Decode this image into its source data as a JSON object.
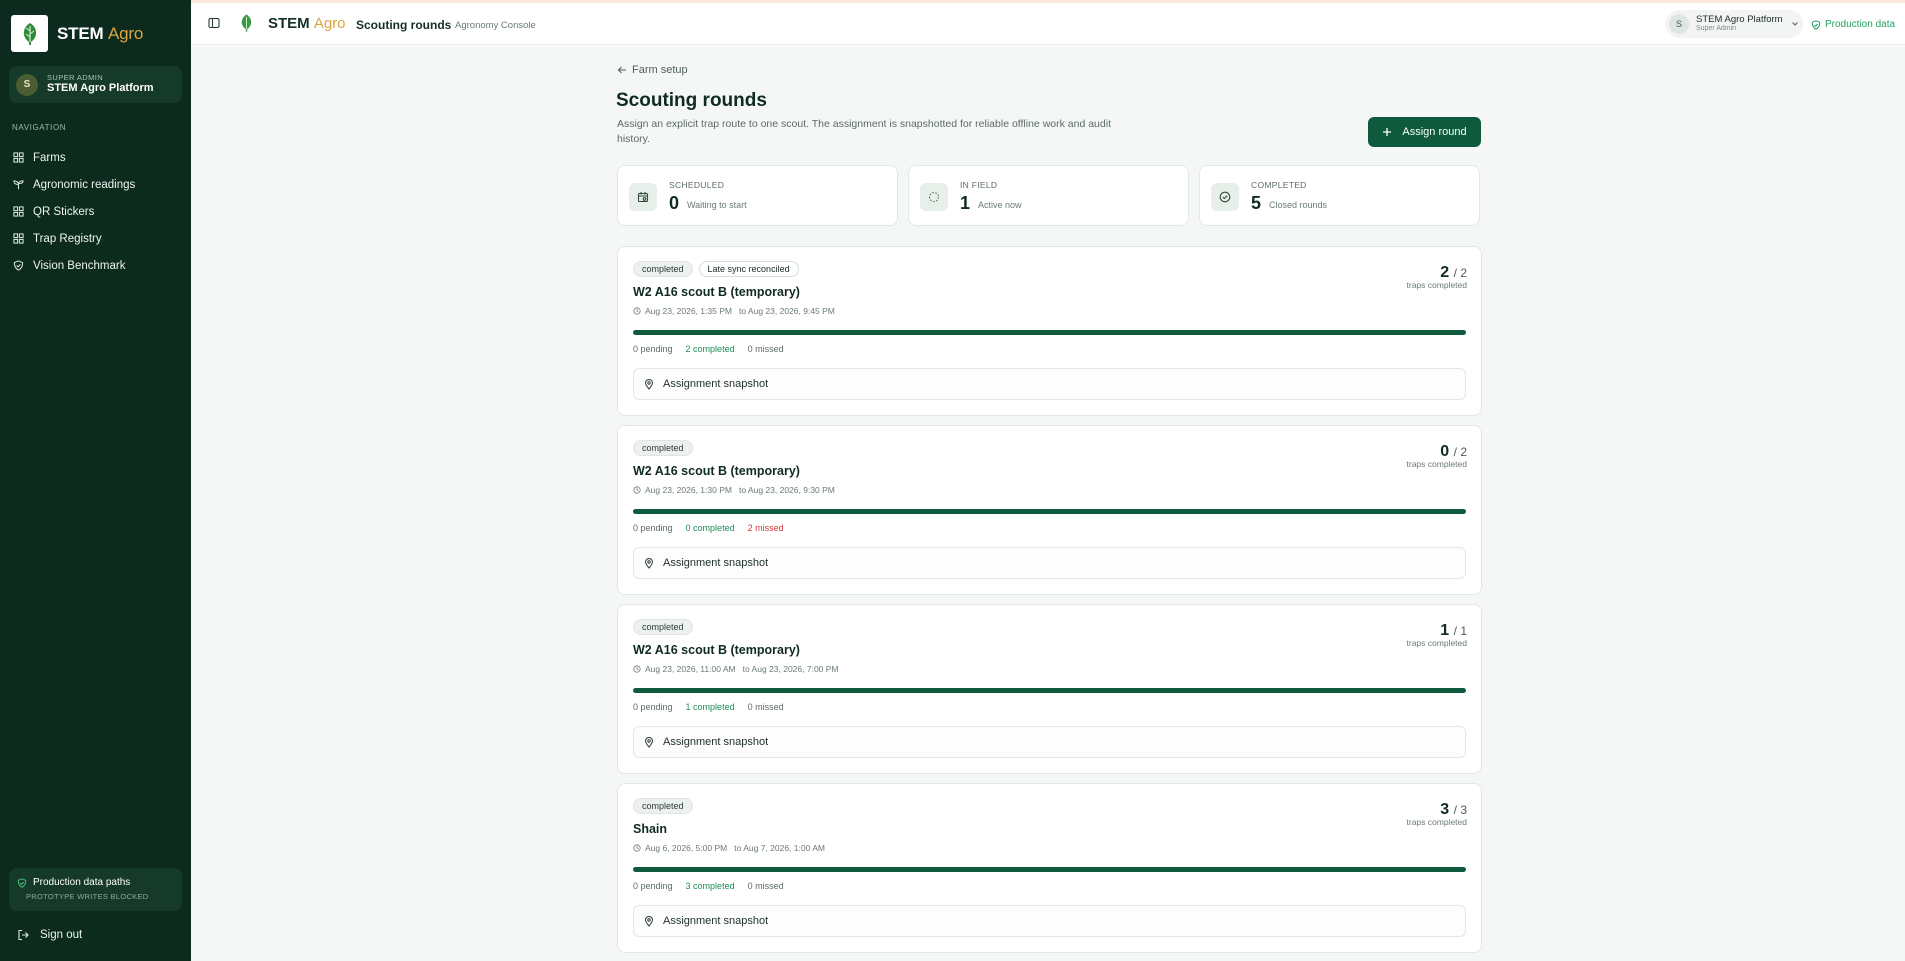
{
  "app": {
    "brand_main": "STEM",
    "brand_accent": "Agro"
  },
  "sidebar": {
    "user_role": "SUPER ADMIN",
    "user_name": "STEM Agro Platform",
    "avatar_letter": "S",
    "nav_label": "NAVIGATION",
    "items": [
      {
        "label": "Farms",
        "icon": "grid-icon"
      },
      {
        "label": "Agronomic readings",
        "icon": "sprout-icon"
      },
      {
        "label": "QR Stickers",
        "icon": "grid-icon"
      },
      {
        "label": "Trap Registry",
        "icon": "grid-icon"
      },
      {
        "label": "Vision Benchmark",
        "icon": "shield-check-icon"
      }
    ],
    "prod_title": "Production data paths",
    "prod_sub": "PROTOTYPE WRITES BLOCKED",
    "signout": "Sign out"
  },
  "topbar": {
    "page_title": "Scouting rounds",
    "subtitle": "Agronomy Console",
    "user_name": "STEM Agro Platform",
    "user_role": "Super Admin",
    "avatar_letter": "S",
    "prod_badge": "Production data"
  },
  "page": {
    "back_label": "Farm setup",
    "title": "Scouting rounds",
    "description": "Assign an explicit trap route to one scout. The assignment is snapshotted for reliable offline work and audit history.",
    "assign_label": "Assign round"
  },
  "stats": [
    {
      "label": "SCHEDULED",
      "value": "0",
      "desc": "Waiting to start",
      "icon": "calendar-icon"
    },
    {
      "label": "IN FIELD",
      "value": "1",
      "desc": "Active now",
      "icon": "loader-icon"
    },
    {
      "label": "COMPLETED",
      "value": "5",
      "desc": "Closed rounds",
      "icon": "check-circle-icon"
    }
  ],
  "rounds_caption": "traps completed",
  "snapshot_label": "Assignment snapshot",
  "rounds": [
    {
      "status": "completed",
      "extra_badge": "Late sync reconciled",
      "name": "W2 A16 scout B (temporary)",
      "from": "Aug 23, 2026, 1:35 PM",
      "to": "to Aug 23, 2026, 9:45 PM",
      "done": "2",
      "total": "/ 2",
      "pending": "0 pending",
      "completed": "2 completed",
      "missed": "0 missed",
      "missed_alert": false,
      "progress": 1.0
    },
    {
      "status": "completed",
      "extra_badge": "",
      "name": "W2 A16 scout B (temporary)",
      "from": "Aug 23, 2026, 1:30 PM",
      "to": "to Aug 23, 2026, 9:30 PM",
      "done": "0",
      "total": "/ 2",
      "pending": "0 pending",
      "completed": "0 completed",
      "missed": "2 missed",
      "missed_alert": true,
      "progress": 1.0
    },
    {
      "status": "completed",
      "extra_badge": "",
      "name": "W2 A16 scout B (temporary)",
      "from": "Aug 23, 2026, 11:00 AM",
      "to": "to Aug 23, 2026, 7:00 PM",
      "done": "1",
      "total": "/ 1",
      "pending": "0 pending",
      "completed": "1 completed",
      "missed": "0 missed",
      "missed_alert": false,
      "progress": 1.0
    },
    {
      "status": "completed",
      "extra_badge": "",
      "name": "Shain",
      "from": "Aug 6, 2026, 5:00 PM",
      "to": "to Aug 7, 2026, 1:00 AM",
      "done": "3",
      "total": "/ 3",
      "pending": "0 pending",
      "completed": "3 completed",
      "missed": "0 missed",
      "missed_alert": false,
      "progress": 1.0
    }
  ]
}
